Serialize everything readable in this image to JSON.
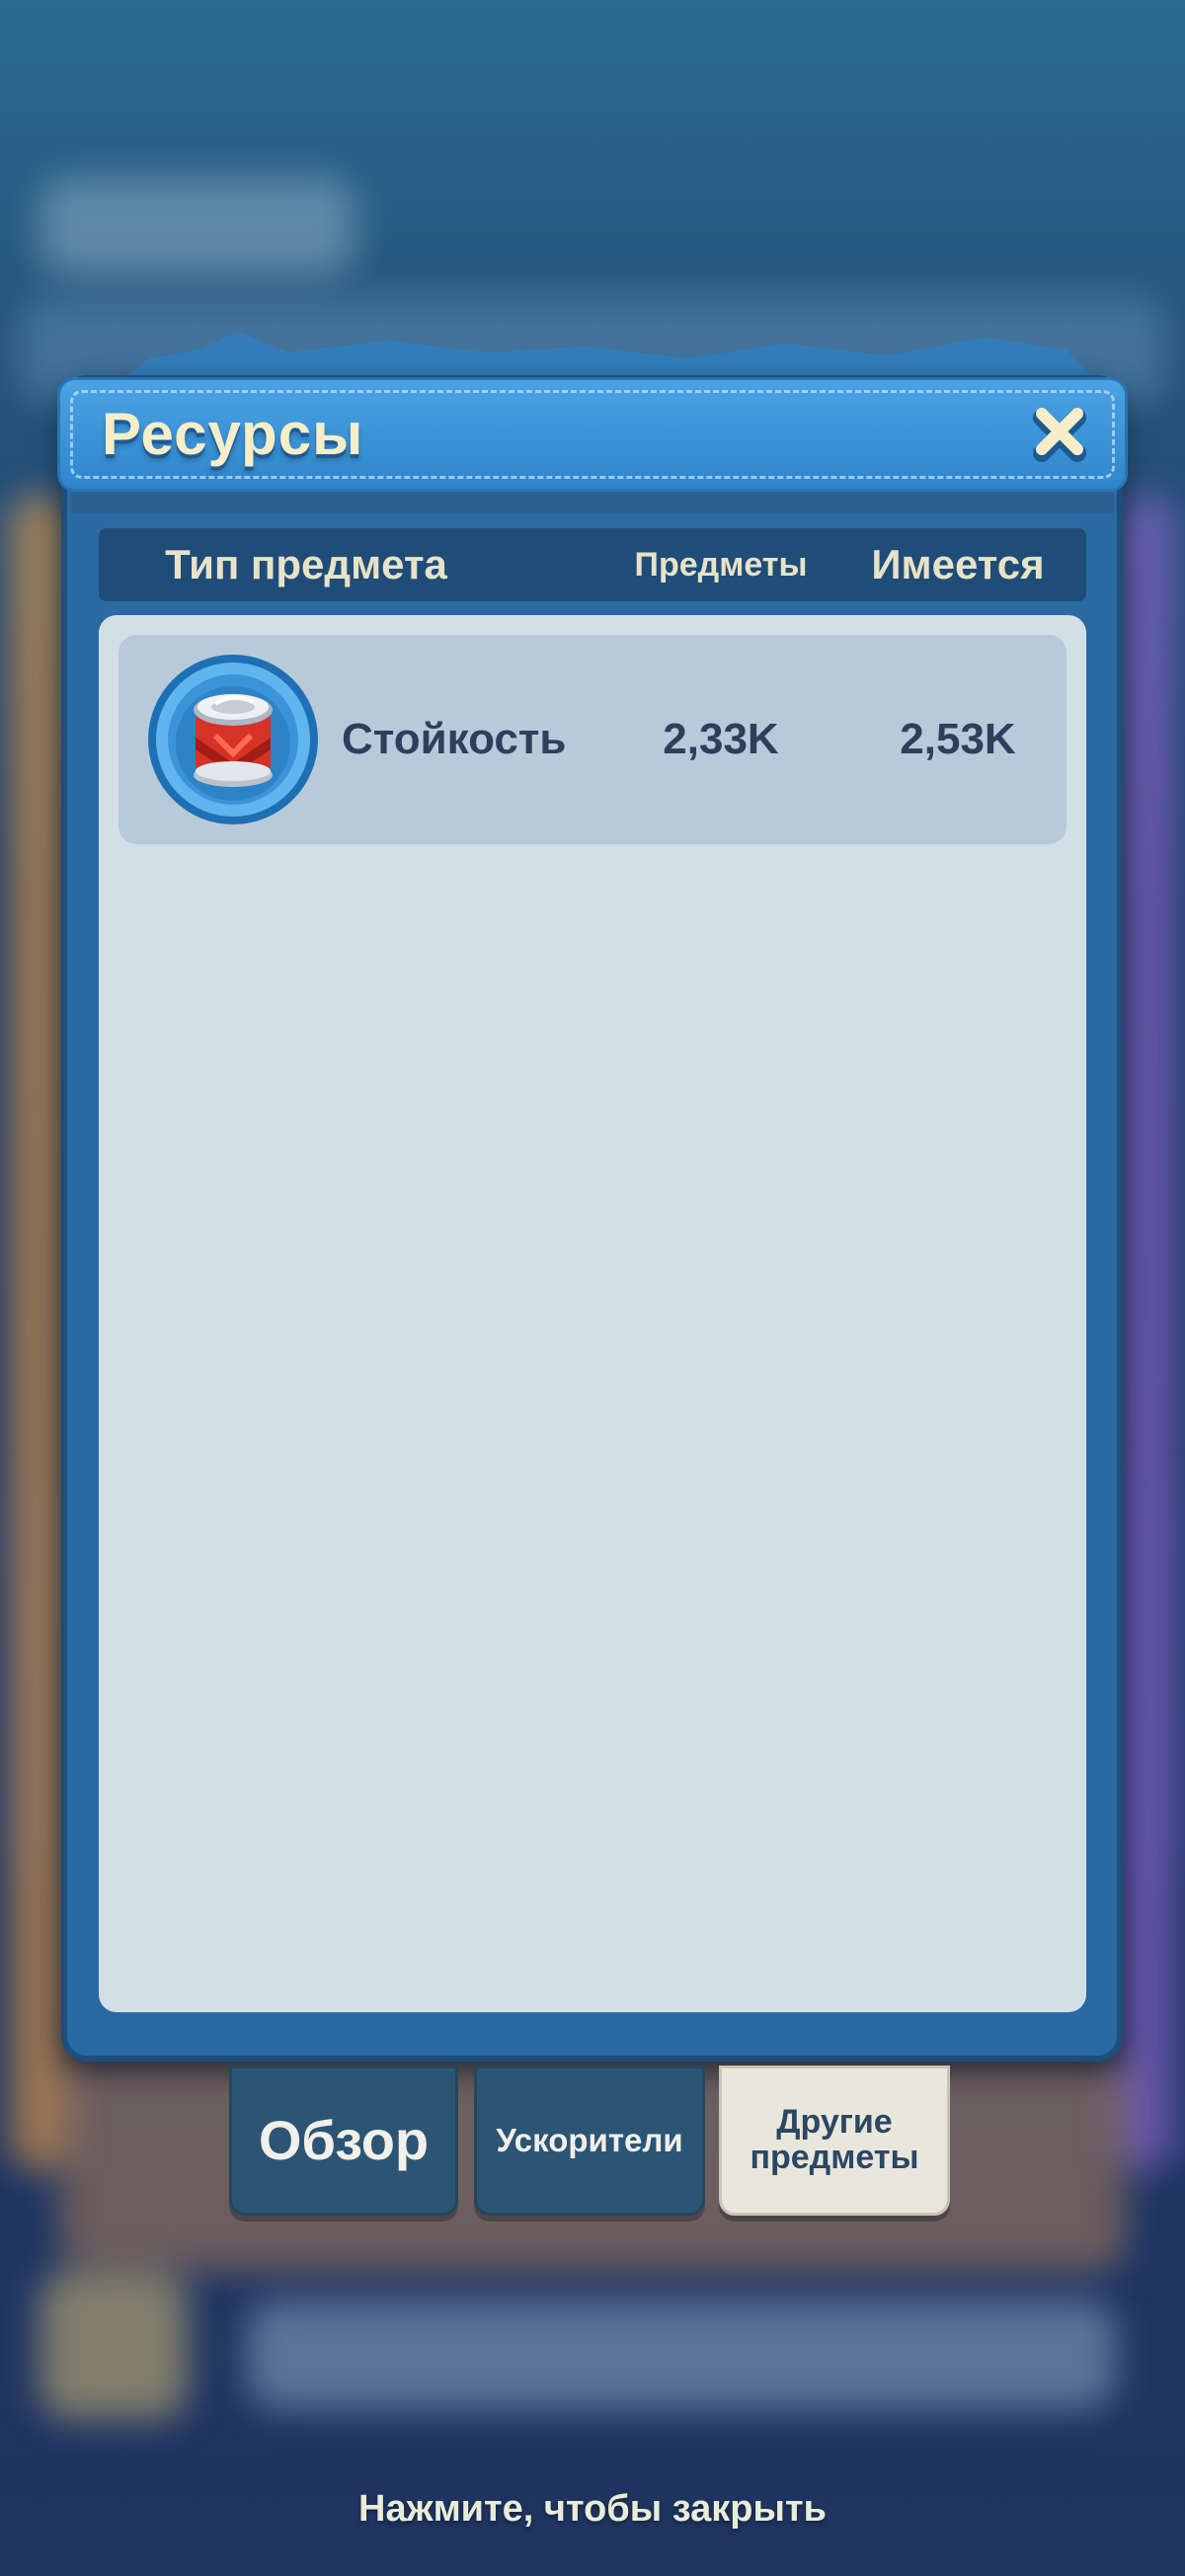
{
  "dialog": {
    "title": "Ресурсы",
    "close_icon": "close-icon"
  },
  "columns": {
    "type": "Тип предмета",
    "items": "Предметы",
    "have": "Имеется"
  },
  "rows": [
    {
      "icon": "endurance-can-icon",
      "name": "Стойкость",
      "items": "2,33K",
      "have": "2,53K"
    }
  ],
  "tabs": [
    {
      "label": "Обзор",
      "active": false
    },
    {
      "label": "Ускорители",
      "active": false
    },
    {
      "label": "Другие предметы",
      "active": true
    }
  ],
  "footer": {
    "hint": "Нажмите, чтобы закрыть"
  },
  "colors": {
    "dialog_blue": "#2a6aa3",
    "header_blue": "#3b93d8",
    "panel_bg": "#d3dfe6",
    "row_bg": "#b6cad9",
    "title_cream": "#f6edc9",
    "active_tab": "#e9e7dd",
    "inactive_tab": "#2c5574"
  }
}
